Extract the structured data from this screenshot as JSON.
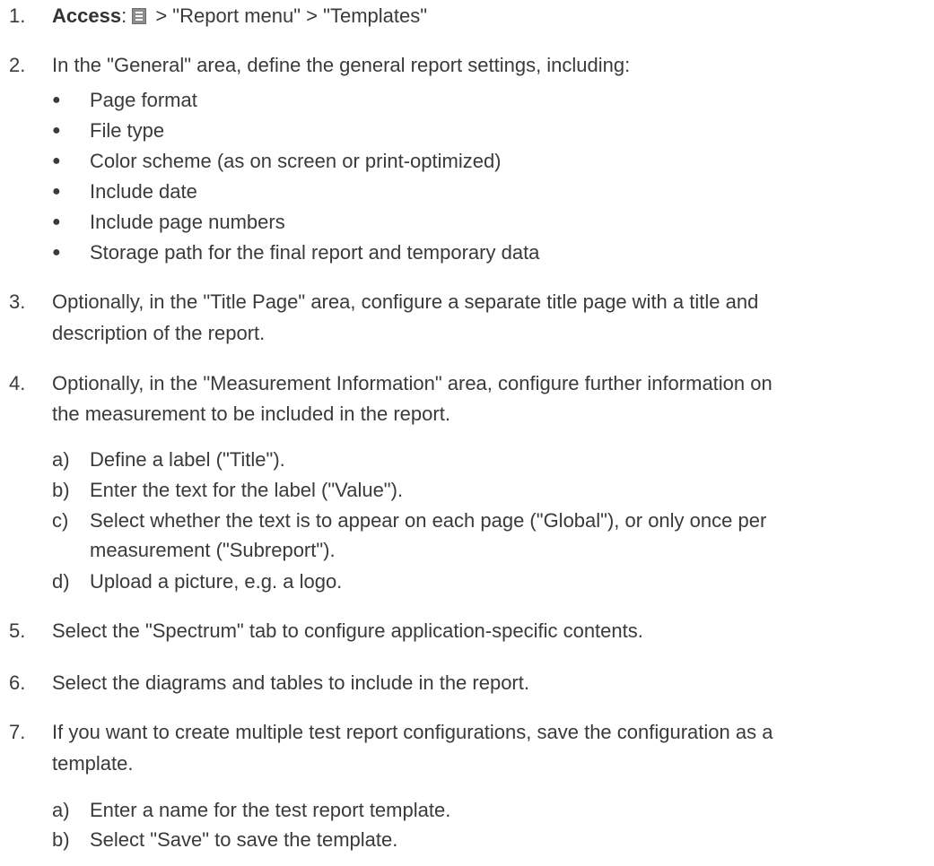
{
  "steps": [
    {
      "number": "1.",
      "access_label": "Access",
      "access_sep": ":",
      "access_path": " > \"Report menu\" > \"Templates\""
    },
    {
      "number": "2.",
      "text": "In the \"General\" area, define the general report settings, including:",
      "bullets": [
        "Page format",
        "File type",
        "Color scheme (as on screen or print-optimized)",
        "Include date",
        "Include page numbers",
        "Storage path for the final report and temporary data"
      ]
    },
    {
      "number": "3.",
      "lines": [
        "Optionally, in the \"Title Page\" area, configure a separate title page with a title and",
        "description of the report."
      ]
    },
    {
      "number": "4.",
      "lines": [
        "Optionally, in the \"Measurement Information\" area, configure further information on",
        "the measurement to be included in the report."
      ],
      "substeps": [
        {
          "letter": "a)",
          "lines": [
            "Define a label (\"Title\")."
          ]
        },
        {
          "letter": "b)",
          "lines": [
            "Enter the text for the label (\"Value\")."
          ]
        },
        {
          "letter": "c)",
          "lines": [
            "Select whether the text is to appear on each page (\"Global\"), or only once per",
            "measurement (\"Subreport\")."
          ]
        },
        {
          "letter": "d)",
          "lines": [
            "Upload a picture, e.g. a logo."
          ]
        }
      ]
    },
    {
      "number": "5.",
      "text": "Select the \"Spectrum\" tab to configure application-specific contents."
    },
    {
      "number": "6.",
      "text": "Select the diagrams and tables to include in the report."
    },
    {
      "number": "7.",
      "lines": [
        "If you want to create multiple test report configurations, save the configuration as a",
        "template."
      ],
      "substeps": [
        {
          "letter": "a)",
          "lines": [
            "Enter a name for the test report template."
          ]
        },
        {
          "letter": "b)",
          "lines": [
            "Select \"Save\" to save the template."
          ]
        }
      ]
    }
  ],
  "bullet_glyph": "●"
}
